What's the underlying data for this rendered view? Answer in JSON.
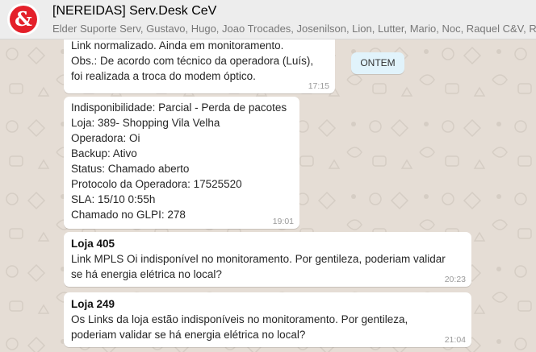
{
  "header": {
    "avatar_icon": "ampersand-logo-icon",
    "avatar_glyph": "&",
    "title": "[NEREIDAS] Serv.Desk CeV",
    "participants": "Elder Suporte Serv, Gustavo, Hugo, Joao Trocades, Josenilson, Lion, Lutter, Mario, Noc, Raquel C&V, Ricar"
  },
  "colors": {
    "chat_background": "#e5ddd5",
    "bubble": "#ffffff",
    "day_chip": "#e1f3fb",
    "brand_red": "#e4202a"
  },
  "day_separator": "ONTEM",
  "messages": [
    {
      "lines": [
        "Link normalizado. Ainda em monitoramento.",
        "Obs.: De acordo com técnico da operadora (Luís),",
        "foi realizada a troca do modem óptico."
      ],
      "time": "17:15"
    },
    {
      "lines": [
        "Indisponibilidade: Parcial - Perda de pacotes",
        "Loja: 389- Shopping Vila Velha",
        "Operadora: Oi",
        "Backup: Ativo",
        "Status: Chamado aberto",
        "Protocolo da Operadora: 17525520",
        "SLA: 15/10 0:55h",
        "Chamado no GLPI: 278"
      ],
      "time": "19:01"
    },
    {
      "heading": "Loja 405",
      "lines": [
        "Link MPLS Oi indisponível no monitoramento. Por gentileza, poderiam validar",
        "se há energia elétrica no local?"
      ],
      "time": "20:23"
    },
    {
      "heading": "Loja 249",
      "lines": [
        "Os Links da loja estão indisponíveis no monitoramento. Por gentileza,",
        "poderiam validar se há energia elétrica no local?"
      ],
      "time": "21:04"
    }
  ]
}
